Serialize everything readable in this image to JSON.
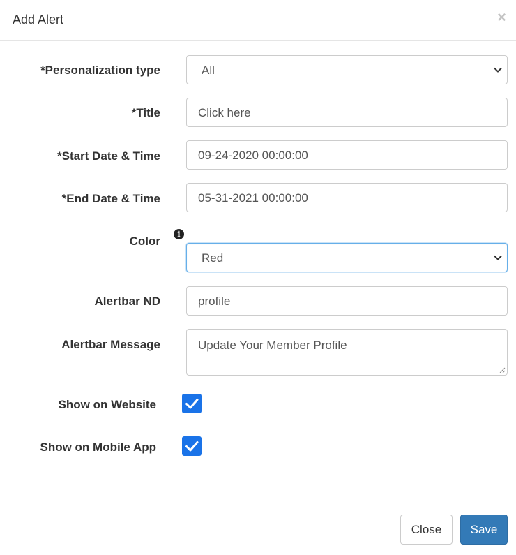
{
  "dialog": {
    "title": "Add Alert",
    "close_symbol": "×"
  },
  "fields": {
    "personalization_type": {
      "label": "*Personalization type",
      "value": "All"
    },
    "title": {
      "label": "*Title",
      "value": "Click here"
    },
    "start_datetime": {
      "label": "*Start Date & Time",
      "value": "09-24-2020 00:00:00"
    },
    "end_datetime": {
      "label": "*End Date & Time",
      "value": "05-31-2021 00:00:00"
    },
    "color": {
      "label": "Color",
      "value": "Red",
      "info_icon": "info-icon"
    },
    "alertbar_nd": {
      "label": "Alertbar ND",
      "value": "profile"
    },
    "alertbar_message": {
      "label": "Alertbar Message",
      "value": "Update Your Member Profile"
    },
    "show_on_website": {
      "label": "Show on Website",
      "checked": true
    },
    "show_on_mobile_app": {
      "label": "Show on Mobile App",
      "checked": true
    }
  },
  "footer": {
    "close_label": "Close",
    "save_label": "Save"
  },
  "colors": {
    "primary": "#337ab7",
    "checkbox": "#1a73e8",
    "focus_border": "#66afe9"
  }
}
